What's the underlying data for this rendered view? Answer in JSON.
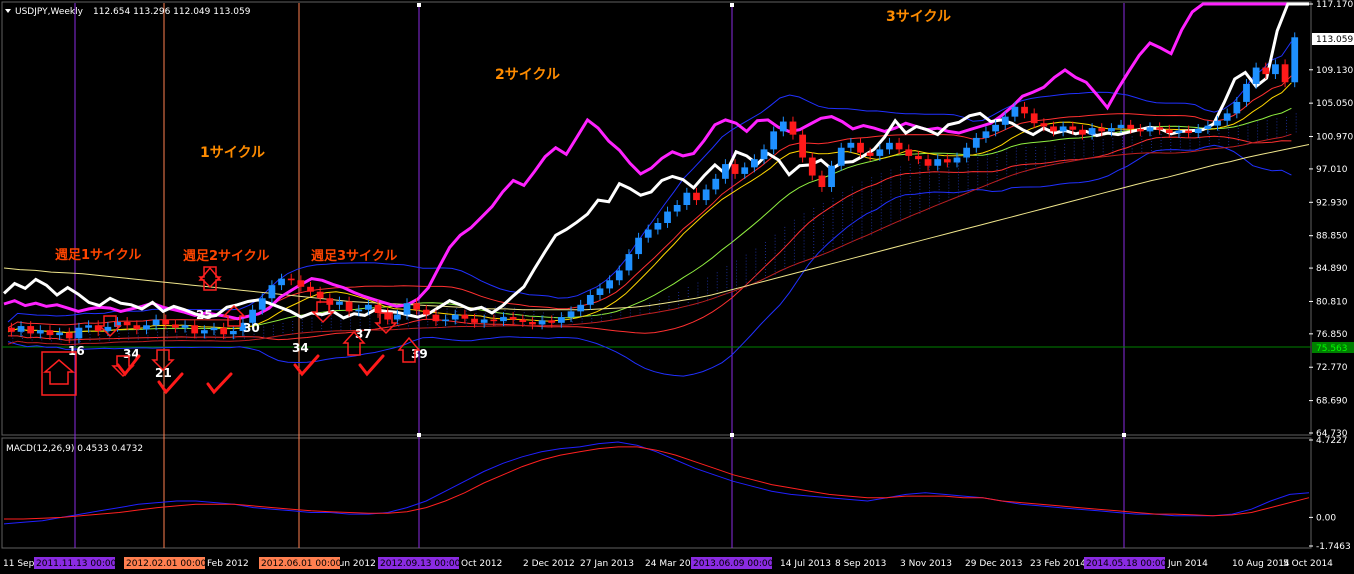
{
  "header": {
    "symbol_info": "USDJPY,Weekly",
    "ohlc": "112.654 113.296 112.049 113.059"
  },
  "macd_header": {
    "label": "MACD(12,26,9) 0.4533 0.4732"
  },
  "colors": {
    "background": "#000000",
    "up_candle": "#1e90ff",
    "down_candle": "#ff1a1a",
    "magenta_line": "#ff22ff",
    "white_line": "#ffffff",
    "vertical_line": "#8a2be2",
    "orange_line": "#ff7f50",
    "green_line": "#008000",
    "annotation_orange": "#ff8c00",
    "annotation_red": "#ff2020"
  },
  "chart_data": [
    {
      "type": "line",
      "name": "main",
      "price_axis_ticks": [
        "117.170",
        "113.059",
        "109.130",
        "105.050",
        "100.970",
        "97.010",
        "92.930",
        "88.850",
        "84.890",
        "80.810",
        "76.850",
        "72.770",
        "68.690",
        "64.730"
      ],
      "current_price_label": "113.059",
      "green_level_label": "75.563",
      "ylim": [
        64.73,
        117.17
      ],
      "grid": false,
      "candles_open_close": [
        [
          77.6,
          77.1
        ],
        [
          77.1,
          77.8
        ],
        [
          77.8,
          76.9
        ],
        [
          76.9,
          77.3
        ],
        [
          77.3,
          76.7
        ],
        [
          76.7,
          77.0
        ],
        [
          77.0,
          76.3
        ],
        [
          76.3,
          77.6
        ],
        [
          77.6,
          77.9
        ],
        [
          77.9,
          77.2
        ],
        [
          77.2,
          77.7
        ],
        [
          77.7,
          78.3
        ],
        [
          78.3,
          77.9
        ],
        [
          77.9,
          77.4
        ],
        [
          77.4,
          77.9
        ],
        [
          77.9,
          78.6
        ],
        [
          78.6,
          78.0
        ],
        [
          78.0,
          77.6
        ],
        [
          77.6,
          77.9
        ],
        [
          77.9,
          76.9
        ],
        [
          76.9,
          77.3
        ],
        [
          77.3,
          77.6
        ],
        [
          77.6,
          76.8
        ],
        [
          76.8,
          77.2
        ],
        [
          77.2,
          78.2
        ],
        [
          78.2,
          79.8
        ],
        [
          79.8,
          81.2
        ],
        [
          81.2,
          82.8
        ],
        [
          82.8,
          83.6
        ],
        [
          83.6,
          83.4
        ],
        [
          83.4,
          82.6
        ],
        [
          82.6,
          82.0
        ],
        [
          82.0,
          81.2
        ],
        [
          81.2,
          80.4
        ],
        [
          80.4,
          80.8
        ],
        [
          80.8,
          79.6
        ],
        [
          79.6,
          79.8
        ],
        [
          79.8,
          80.4
        ],
        [
          80.4,
          79.4
        ],
        [
          79.4,
          78.6
        ],
        [
          78.6,
          79.2
        ],
        [
          79.2,
          80.6
        ],
        [
          80.6,
          79.8
        ],
        [
          79.8,
          79.2
        ],
        [
          79.2,
          78.4
        ],
        [
          78.4,
          78.6
        ],
        [
          78.6,
          79.2
        ],
        [
          79.2,
          78.7
        ],
        [
          78.7,
          78.2
        ],
        [
          78.2,
          78.6
        ],
        [
          78.6,
          78.4
        ],
        [
          78.4,
          78.9
        ],
        [
          78.9,
          78.6
        ],
        [
          78.6,
          78.3
        ],
        [
          78.3,
          78.0
        ],
        [
          78.0,
          78.5
        ],
        [
          78.5,
          78.2
        ],
        [
          78.2,
          78.9
        ],
        [
          78.9,
          79.6
        ],
        [
          79.6,
          80.4
        ],
        [
          80.4,
          81.6
        ],
        [
          81.6,
          82.4
        ],
        [
          82.4,
          83.4
        ],
        [
          83.4,
          84.6
        ],
        [
          84.6,
          86.6
        ],
        [
          86.6,
          88.6
        ],
        [
          88.6,
          89.6
        ],
        [
          89.6,
          90.4
        ],
        [
          90.4,
          91.8
        ],
        [
          91.8,
          92.6
        ],
        [
          92.6,
          94.1
        ],
        [
          94.1,
          93.2
        ],
        [
          93.2,
          94.5
        ],
        [
          94.5,
          95.8
        ],
        [
          95.8,
          97.6
        ],
        [
          97.6,
          96.4
        ],
        [
          96.4,
          97.2
        ],
        [
          97.2,
          98.2
        ],
        [
          98.2,
          99.4
        ],
        [
          99.4,
          101.6
        ],
        [
          101.6,
          102.8
        ],
        [
          102.8,
          101.2
        ],
        [
          101.2,
          98.4
        ],
        [
          98.4,
          96.2
        ],
        [
          96.2,
          94.8
        ],
        [
          94.8,
          97.4
        ],
        [
          97.4,
          99.6
        ],
        [
          99.6,
          100.2
        ],
        [
          100.2,
          99.0
        ],
        [
          99.0,
          98.6
        ],
        [
          98.6,
          99.4
        ],
        [
          99.4,
          100.2
        ],
        [
          100.2,
          99.4
        ],
        [
          99.4,
          98.6
        ],
        [
          98.6,
          98.2
        ],
        [
          98.2,
          97.4
        ],
        [
          97.4,
          98.2
        ],
        [
          98.2,
          97.8
        ],
        [
          97.8,
          98.4
        ],
        [
          98.4,
          99.6
        ],
        [
          99.6,
          100.8
        ],
        [
          100.8,
          101.6
        ],
        [
          101.6,
          102.4
        ],
        [
          102.4,
          103.4
        ],
        [
          103.4,
          104.6
        ],
        [
          104.6,
          103.8
        ],
        [
          103.8,
          102.6
        ],
        [
          102.6,
          102.2
        ],
        [
          102.2,
          101.6
        ],
        [
          101.6,
          102.2
        ],
        [
          102.2,
          101.8
        ],
        [
          101.8,
          101.2
        ],
        [
          101.2,
          102.0
        ],
        [
          102.0,
          101.6
        ],
        [
          101.6,
          102.0
        ],
        [
          102.0,
          102.4
        ],
        [
          102.4,
          101.9
        ],
        [
          101.9,
          101.6
        ],
        [
          101.6,
          102.1
        ],
        [
          102.1,
          101.8
        ],
        [
          101.8,
          101.4
        ],
        [
          101.4,
          101.7
        ],
        [
          101.7,
          101.4
        ],
        [
          101.4,
          101.9
        ],
        [
          101.9,
          102.3
        ],
        [
          102.3,
          102.9
        ],
        [
          102.9,
          103.8
        ],
        [
          103.8,
          105.2
        ],
        [
          105.2,
          107.4
        ],
        [
          107.4,
          109.4
        ],
        [
          109.4,
          108.6
        ],
        [
          108.6,
          109.8
        ],
        [
          109.8,
          107.6
        ],
        [
          107.6,
          113.1
        ]
      ],
      "overlay_lines": {
        "white": [
          81.8,
          83.0,
          82.4,
          83.5,
          82.8,
          81.6,
          82.5,
          81.7,
          80.7,
          80.3,
          81.2,
          80.6,
          80.4,
          79.9,
          80.7,
          79.6,
          80.2,
          79.8,
          79.3,
          78.9,
          79.1,
          80.1,
          80.4,
          80.8,
          81.0,
          80.6,
          80.1,
          79.6,
          78.9,
          79.4,
          79.2,
          79.6,
          78.8,
          79.3,
          79.1,
          79.8,
          79.6,
          79.5,
          79.2,
          78.9,
          79.3,
          80.1,
          80.9,
          80.4,
          79.8,
          80.1,
          79.4,
          80.3,
          81.5,
          82.6,
          84.8,
          86.9,
          88.9,
          89.6,
          90.5,
          91.5,
          93.2,
          93.0,
          95.2,
          94.6,
          93.8,
          94.2,
          95.6,
          96.1,
          95.7,
          94.7,
          96.2,
          97.5,
          96.4,
          99.1,
          98.6,
          97.6,
          98.9,
          98.1,
          96.3,
          97.4,
          97.5,
          98.1,
          97.0,
          97.8,
          97.9,
          98.6,
          99.4,
          100.9,
          102.9,
          101.4,
          102.2,
          101.8,
          101.2,
          102.4,
          102.7,
          103.5,
          103.8,
          102.8,
          103.0,
          102.6,
          101.8,
          101.2,
          102.0,
          101.4,
          101.7,
          101.3,
          101.6,
          101.1,
          101.4,
          101.2,
          101.5,
          101.8,
          102.1,
          101.9,
          101.3,
          101.6,
          101.7,
          101.8,
          102.5,
          105.1,
          108.0,
          108.8,
          107.1,
          108.1,
          113.9,
          117.5,
          118.8,
          119.5
        ],
        "magenta": [
          80.5,
          80.9,
          80.3,
          80.6,
          80.2,
          80.4,
          80.0,
          79.6,
          79.9,
          80.1,
          80.0,
          79.6,
          79.9,
          80.2,
          80.6,
          80.1,
          79.8,
          79.5,
          79.1,
          79.4,
          79.2,
          79.0,
          78.7,
          79.0,
          79.3,
          80.0,
          81.3,
          82.1,
          82.9,
          83.6,
          83.4,
          82.9,
          82.5,
          81.9,
          81.4,
          81.0,
          80.6,
          80.2,
          80.4,
          81.1,
          82.5,
          85.0,
          87.4,
          88.9,
          89.8,
          91.1,
          92.4,
          94.2,
          95.6,
          95.0,
          96.7,
          98.5,
          99.6,
          98.8,
          100.9,
          103.0,
          102.0,
          100.4,
          99.3,
          97.7,
          96.4,
          97.1,
          98.3,
          99.1,
          98.6,
          98.9,
          100.5,
          102.4,
          103.0,
          102.6,
          101.6,
          102.9,
          103.0,
          102.1,
          101.6,
          101.8,
          102.5,
          103.2,
          103.4,
          102.8,
          101.9,
          102.3,
          102.0,
          101.6,
          102.0,
          102.6,
          102.2,
          101.8,
          102.0,
          101.6,
          101.4,
          101.8,
          102.2,
          102.6,
          103.5,
          104.6,
          105.9,
          106.4,
          107.0,
          108.2,
          109.1,
          108.2,
          107.6,
          106.1,
          104.5,
          106.8,
          108.9,
          110.9,
          112.4,
          111.8,
          111.1,
          114.0,
          116.2,
          117.5,
          119.0,
          119.8,
          120.4,
          120.9,
          121.3,
          121.6,
          121.8,
          122.0,
          122.2,
          122.4
        ],
        "ma_yellow": [
          84.9,
          84.7,
          84.6,
          84.4,
          84.3,
          84.2,
          84.0,
          83.8,
          83.6,
          83.4,
          83.2,
          83.0,
          82.8,
          82.6,
          82.4,
          82.2,
          82.0,
          81.8,
          81.6,
          81.4,
          81.2,
          81.0,
          80.8,
          80.7,
          80.6,
          80.5,
          80.4,
          80.3,
          80.2,
          80.1,
          80.0,
          79.9,
          79.9,
          79.8,
          79.8,
          79.8,
          79.8,
          79.8,
          79.9,
          80.0,
          80.1,
          80.3,
          80.6,
          80.9,
          81.2,
          81.6,
          82.1,
          82.6,
          83.1,
          83.6,
          84.1,
          84.6,
          85.1,
          85.6,
          86.1,
          86.6,
          87.1,
          87.6,
          88.1,
          88.6,
          89.1,
          89.6,
          90.1,
          90.6,
          91.1,
          91.6,
          92.1,
          92.6,
          93.1,
          93.6,
          94.1,
          94.6,
          95.1,
          95.6,
          96.0,
          96.5,
          97.0,
          97.5,
          97.9,
          98.4,
          98.8,
          99.2,
          99.6,
          100.0
        ]
      },
      "macd_axis_ticks": [
        "4.7227",
        "0.00",
        "-1.7463"
      ],
      "macd_ylim": [
        -1.7463,
        4.7227
      ],
      "macd_line": [
        -0.4,
        -0.3,
        -0.2,
        0.0,
        0.2,
        0.4,
        0.6,
        0.8,
        0.9,
        1.0,
        1.0,
        0.9,
        0.8,
        0.6,
        0.5,
        0.4,
        0.3,
        0.3,
        0.2,
        0.2,
        0.3,
        0.6,
        1.0,
        1.6,
        2.2,
        2.8,
        3.3,
        3.7,
        4.0,
        4.2,
        4.3,
        4.5,
        4.6,
        4.4,
        4.0,
        3.5,
        3.0,
        2.6,
        2.2,
        1.9,
        1.6,
        1.4,
        1.3,
        1.2,
        1.1,
        1.0,
        1.2,
        1.4,
        1.5,
        1.4,
        1.3,
        1.2,
        1.0,
        0.8,
        0.7,
        0.6,
        0.5,
        0.4,
        0.3,
        0.2,
        0.2,
        0.1,
        0.1,
        0.1,
        0.2,
        0.5,
        1.0,
        1.4,
        1.5
      ],
      "signal_line": [
        -0.1,
        -0.1,
        -0.05,
        0.0,
        0.1,
        0.2,
        0.3,
        0.45,
        0.6,
        0.7,
        0.8,
        0.8,
        0.8,
        0.7,
        0.6,
        0.5,
        0.4,
        0.35,
        0.3,
        0.25,
        0.25,
        0.35,
        0.6,
        1.0,
        1.5,
        2.1,
        2.6,
        3.1,
        3.5,
        3.8,
        4.0,
        4.2,
        4.3,
        4.3,
        4.1,
        3.8,
        3.4,
        3.0,
        2.6,
        2.3,
        2.0,
        1.8,
        1.6,
        1.4,
        1.3,
        1.2,
        1.2,
        1.3,
        1.3,
        1.3,
        1.2,
        1.2,
        1.0,
        0.9,
        0.8,
        0.7,
        0.6,
        0.5,
        0.4,
        0.3,
        0.2,
        0.2,
        0.15,
        0.1,
        0.15,
        0.3,
        0.6,
        0.9,
        1.2
      ]
    }
  ],
  "time_axis": {
    "labels": [
      "11 Sep",
      "Feb 2012",
      "Jun 2012",
      "Oct 2012",
      "2 Dec 2012",
      "27 Jan 2013",
      "24 Mar 2013",
      "14 Jul 2013",
      "8 Sep 2013",
      "3 Nov 2013",
      "29 Dec 2013",
      "23 Feb 2014",
      "Jun 2014",
      "10 Aug 2014",
      "5 Oct 2014"
    ],
    "highlight_labels": [
      {
        "text": "2011.11.13 00:00",
        "kind": "purple"
      },
      {
        "text": "2012.02.01 00:00",
        "kind": "orange"
      },
      {
        "text": "2012.06.01 00:00",
        "kind": "orange"
      },
      {
        "text": "2012.09.13 00:00",
        "kind": "purple"
      },
      {
        "text": "2013.06.09 00:00",
        "kind": "purple"
      },
      {
        "text": "2014.05.18 00:00",
        "kind": "purple"
      }
    ]
  },
  "annotations": {
    "cycle1": "1サイクル",
    "cycle2": "2サイクル",
    "cycle3": "3サイクル",
    "weekly1": "週足1サイクル",
    "weekly2": "週足2サイクル",
    "weekly3": "週足3サイクル",
    "counts": [
      "16",
      "34",
      "21",
      "25",
      "30",
      "34",
      "37",
      "39"
    ]
  }
}
